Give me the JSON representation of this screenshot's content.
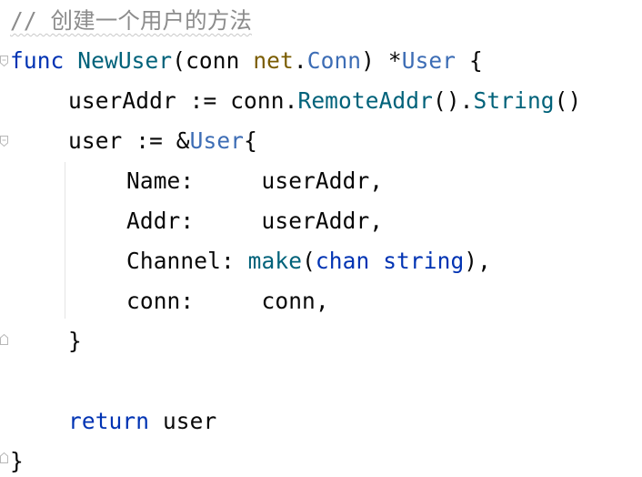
{
  "editor": {
    "comment_line": "// 创建一个用户的方法",
    "l1": {
      "kw_func": "func",
      "fn_name": "NewUser",
      "paren_open": "(conn ",
      "pkg": "net",
      "dot": ".",
      "type_conn": "Conn",
      "paren_close": ") *",
      "type_user": "User",
      "brace": " {"
    },
    "l2": {
      "lhs": "userAddr := conn.",
      "method1": "RemoteAddr",
      "mid": "().",
      "method2": "String",
      "end": "()"
    },
    "l3": {
      "lhs": "user := &",
      "type_user": "User",
      "brace": "{"
    },
    "l4": {
      "text": "Name:     userAddr,"
    },
    "l5": {
      "text": "Addr:     userAddr,"
    },
    "l6": {
      "field": "Channel: ",
      "make": "make",
      "paren": "(",
      "chan": "chan",
      "space": " ",
      "string": "string",
      "end": "),"
    },
    "l7": {
      "text": "conn:     conn,"
    },
    "l8": {
      "text": "}"
    },
    "l10": {
      "kw_return": "return",
      "rest": " user"
    },
    "l11": {
      "text": "}"
    }
  }
}
